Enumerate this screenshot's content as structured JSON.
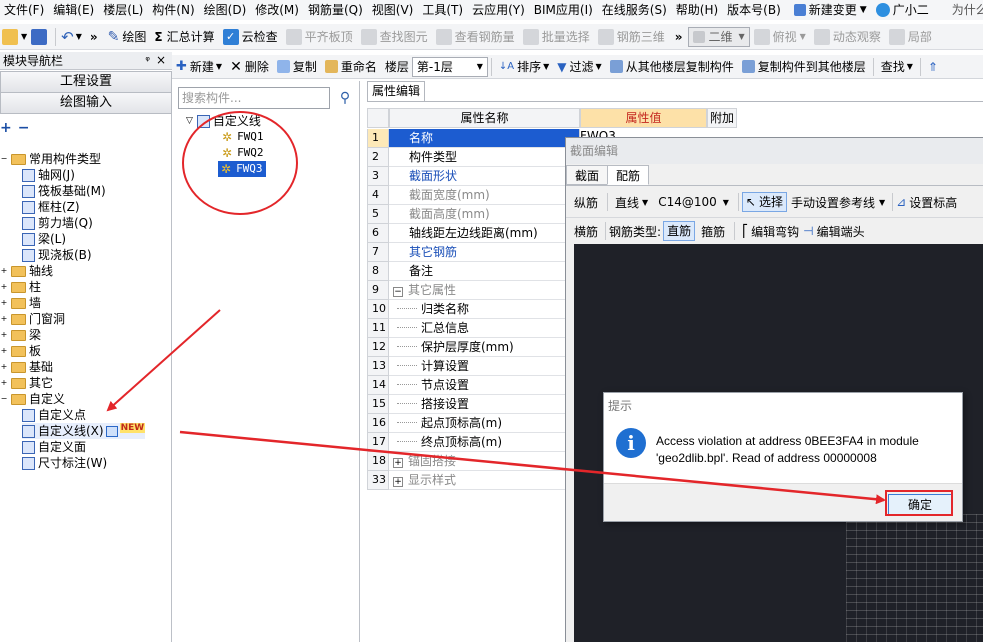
{
  "menu": [
    "文件(F)",
    "编辑(E)",
    "楼层(L)",
    "构件(N)",
    "绘图(D)",
    "修改(M)",
    "钢筋量(Q)",
    "视图(V)",
    "工具(T)",
    "云应用(Y)",
    "BIM应用(I)",
    "在线服务(S)",
    "帮助(H)",
    "版本号(B)"
  ],
  "menu_right": {
    "new_change": "新建变更",
    "user": "广小二",
    "hint": "为什么"
  },
  "toolbar1": {
    "draw": "绘图",
    "sum": "汇总计算",
    "cloud_check": "云检查",
    "flat_plate": "平齐板顶",
    "find_element": "查找图元",
    "view_rebar": "查看钢筋量",
    "batch_select": "批量选择",
    "rebar_3d": "钢筋三维",
    "view_mode": "二维",
    "top_view": "俯视",
    "dynamic": "动态观察",
    "local": "局部"
  },
  "nav": {
    "title": "模块导航栏",
    "pin": "ᵠ",
    "close": "×",
    "btn_project": "工程设置",
    "btn_draw": "绘图输入",
    "tree": [
      {
        "label": "常用构件类型",
        "level": 0,
        "type": "folder",
        "expanded": true
      },
      {
        "label": "轴网(J)",
        "level": 1,
        "type": "leaf"
      },
      {
        "label": "筏板基础(M)",
        "level": 1,
        "type": "leaf"
      },
      {
        "label": "框柱(Z)",
        "level": 1,
        "type": "leaf"
      },
      {
        "label": "剪力墙(Q)",
        "level": 1,
        "type": "leaf"
      },
      {
        "label": "梁(L)",
        "level": 1,
        "type": "leaf"
      },
      {
        "label": "现浇板(B)",
        "level": 1,
        "type": "leaf"
      },
      {
        "label": "轴线",
        "level": 0,
        "type": "folder"
      },
      {
        "label": "柱",
        "level": 0,
        "type": "folder"
      },
      {
        "label": "墙",
        "level": 0,
        "type": "folder"
      },
      {
        "label": "门窗洞",
        "level": 0,
        "type": "folder"
      },
      {
        "label": "梁",
        "level": 0,
        "type": "folder"
      },
      {
        "label": "板",
        "level": 0,
        "type": "folder"
      },
      {
        "label": "基础",
        "level": 0,
        "type": "folder"
      },
      {
        "label": "其它",
        "level": 0,
        "type": "folder"
      },
      {
        "label": "自定义",
        "level": 0,
        "type": "folder",
        "expanded": true
      },
      {
        "label": "自定义点",
        "level": 1,
        "type": "leaf"
      },
      {
        "label": "自定义线(X)",
        "level": 1,
        "type": "leaf",
        "badge": "NEW"
      },
      {
        "label": "自定义面",
        "level": 1,
        "type": "leaf"
      },
      {
        "label": "尺寸标注(W)",
        "level": 1,
        "type": "leaf"
      }
    ]
  },
  "toolbar2": {
    "new": "新建",
    "delete": "删除",
    "copy": "复制",
    "rename": "重命名",
    "floor_label": "楼层",
    "floor_value": "第-1层",
    "sort": "排序",
    "filter": "过滤",
    "copy_from": "从其他楼层复制构件",
    "copy_to": "复制构件到其他楼层",
    "find": "查找"
  },
  "mid": {
    "search_placeholder": "搜索构件...",
    "root": "自定义线",
    "items": [
      "FWQ1",
      "FWQ2",
      "FWQ3"
    ],
    "selected": "FWQ3"
  },
  "props": {
    "tab": "属性编辑",
    "col_name": "属性名称",
    "col_value": "属性值",
    "col_extra": "附加",
    "rows": [
      {
        "n": "1",
        "name": "名称",
        "value": "FWQ3",
        "style": "selected"
      },
      {
        "n": "2",
        "name": "构件类型",
        "value": "",
        "style": ""
      },
      {
        "n": "3",
        "name": "截面形状",
        "value": "",
        "style": "blue"
      },
      {
        "n": "4",
        "name": "截面宽度(mm)",
        "value": "",
        "style": "gray"
      },
      {
        "n": "5",
        "name": "截面高度(mm)",
        "value": "",
        "style": "gray"
      },
      {
        "n": "6",
        "name": "轴线距左边线距离(mm)",
        "value": "",
        "style": ""
      },
      {
        "n": "7",
        "name": "其它钢筋",
        "value": "",
        "style": "blue"
      },
      {
        "n": "8",
        "name": "备注",
        "value": "",
        "style": ""
      },
      {
        "n": "9",
        "name": "其它属性",
        "value": "",
        "style": "group"
      },
      {
        "n": "10",
        "name": "归类名称",
        "value": "",
        "style": "child"
      },
      {
        "n": "11",
        "name": "汇总信息",
        "value": "",
        "style": "child"
      },
      {
        "n": "12",
        "name": "保护层厚度(mm)",
        "value": "",
        "style": "child"
      },
      {
        "n": "13",
        "name": "计算设置",
        "value": "",
        "style": "child"
      },
      {
        "n": "14",
        "name": "节点设置",
        "value": "",
        "style": "child"
      },
      {
        "n": "15",
        "name": "搭接设置",
        "value": "",
        "style": "child"
      },
      {
        "n": "16",
        "name": "起点顶标高(m)",
        "value": "",
        "style": "child"
      },
      {
        "n": "17",
        "name": "终点顶标高(m)",
        "value": "",
        "style": "child"
      },
      {
        "n": "18",
        "name": "锚固搭接",
        "value": "",
        "style": "groupc"
      },
      {
        "n": "33",
        "name": "显示样式",
        "value": "",
        "style": "groupc"
      }
    ]
  },
  "dialog": {
    "title": "截面编辑",
    "tabs": [
      "截面",
      "配筋"
    ],
    "row1": {
      "longitudinal": "纵筋",
      "line": "直线",
      "spec": "C14@100",
      "select": "选择",
      "manual_ref": "手动设置参考线",
      "set_elev": "设置标高"
    },
    "row2": {
      "transverse": "横筋",
      "rebar_type": "钢筋类型:",
      "straight": "直筋",
      "stirrup": "箍筋",
      "edit_hook": "编辑弯钩",
      "edit_end": "编辑端头"
    }
  },
  "msgbox": {
    "title": "提示",
    "icon": "i",
    "line1": "Access violation at address 0BEE3FA4 in module",
    "line2": "'geo2dlib.bpl'. Read of address 00000008",
    "ok": "确定"
  },
  "colors": {
    "annotation_red": "#e3262a",
    "selection_blue": "#1c5cd0",
    "canvas": "#1f2128"
  }
}
